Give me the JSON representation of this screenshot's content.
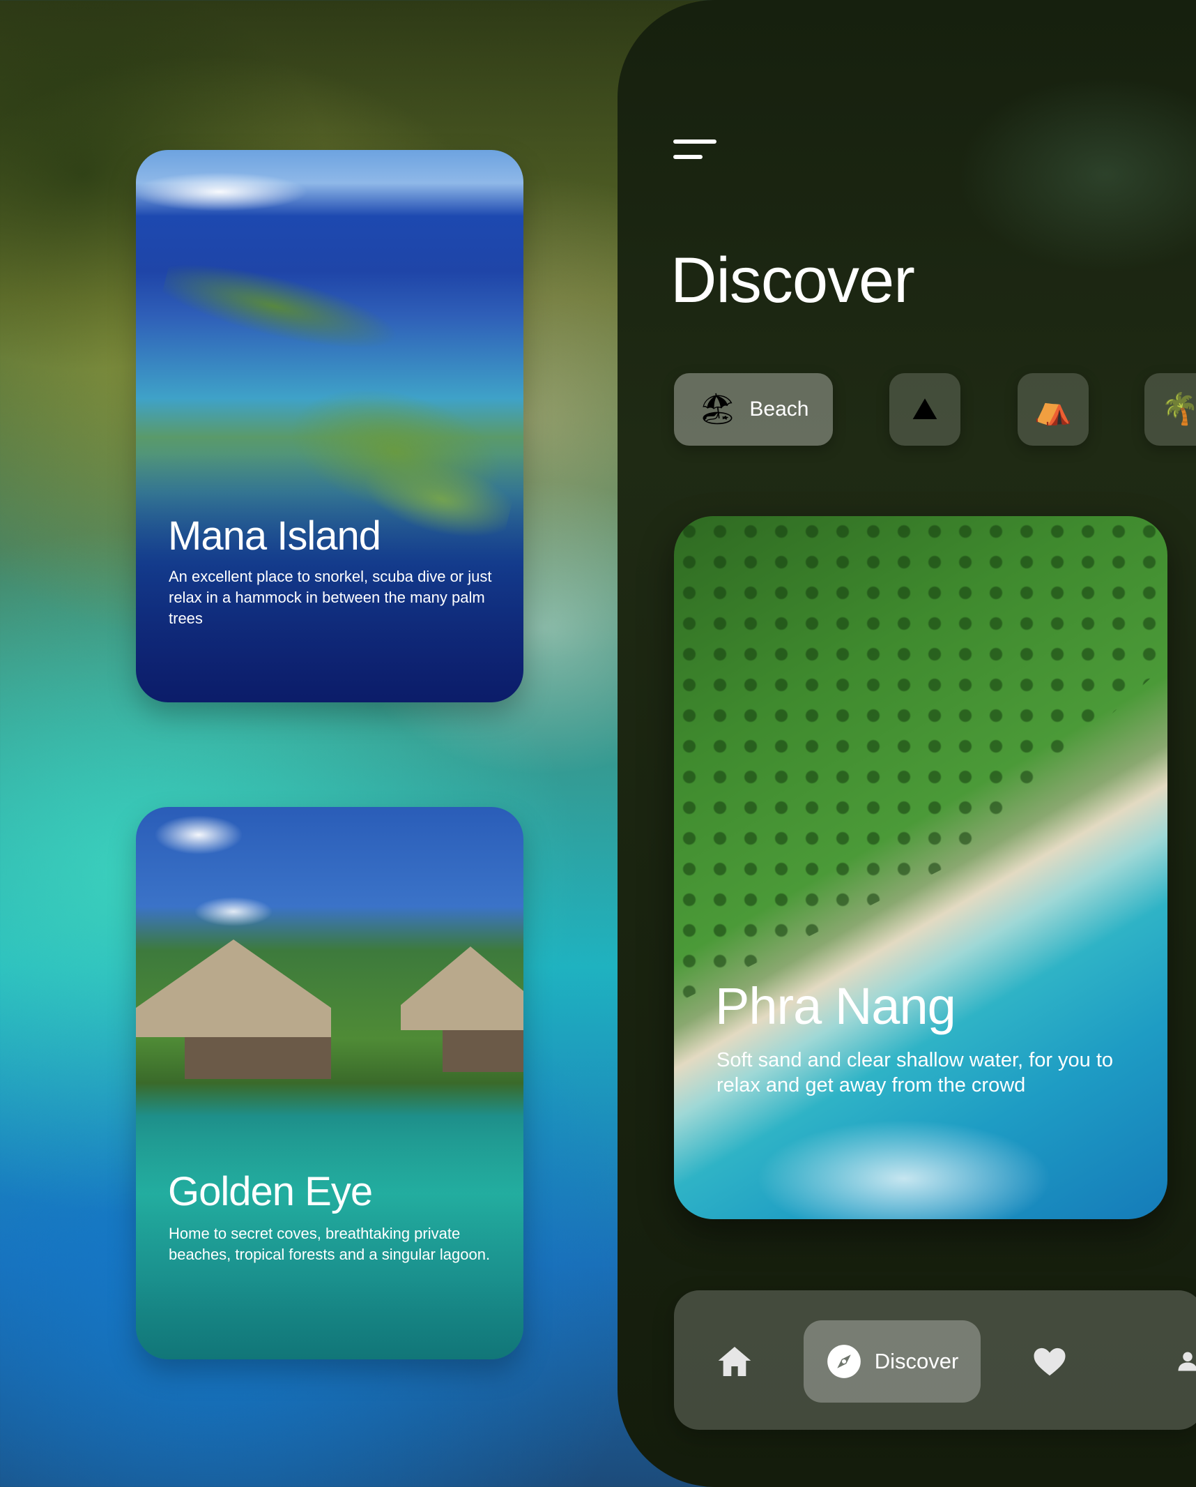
{
  "cards": [
    {
      "title": "Mana Island",
      "description": "An excellent place to snorkel, scuba dive or just relax in a hammock in between the many palm trees"
    },
    {
      "title": "Golden Eye",
      "description": "Home to secret coves, breathtaking private beaches, tropical forests and a singular lagoon."
    }
  ],
  "screen": {
    "title": "Discover",
    "categories": [
      {
        "label": "Beach",
        "icon": "beach-umbrella-icon",
        "selected": true
      },
      {
        "label": "",
        "icon": "mountain-icon",
        "selected": false
      },
      {
        "label": "",
        "icon": "tent-icon",
        "selected": false
      },
      {
        "label": "",
        "icon": "palm-tree-icon",
        "selected": false
      }
    ],
    "featured": {
      "title": "Phra Nang",
      "description": "Soft sand and clear shallow water, for you to relax and get away from the crowd"
    },
    "nav": [
      {
        "label": "",
        "icon": "home-icon"
      },
      {
        "label": "Discover",
        "icon": "compass-icon",
        "active": true
      },
      {
        "label": "",
        "icon": "heart-icon"
      },
      {
        "label": "",
        "icon": "profile-icon"
      }
    ]
  },
  "colors": {
    "nav_icon": "#e6e6e6",
    "text": "#ffffff"
  }
}
